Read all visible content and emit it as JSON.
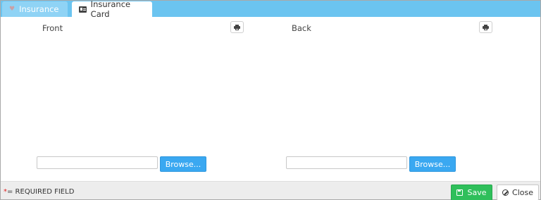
{
  "tabs": [
    {
      "label": "Insurance",
      "icon": "heart-icon",
      "active": false
    },
    {
      "label": "Insurance Card",
      "icon": "id-card-icon",
      "active": true
    }
  ],
  "front": {
    "label": "Front",
    "browse_label": "Browse..."
  },
  "back": {
    "label": "Back",
    "browse_label": "Browse..."
  },
  "footer": {
    "required_star": "*",
    "required_text": "= REQUIRED FIELD",
    "save_label": "Save",
    "close_label": "Close"
  },
  "colors": {
    "tabbar": "#6bc4f0",
    "browse_button": "#3aa8f1",
    "save_button": "#2fbf5b",
    "required_star": "#e02020"
  }
}
